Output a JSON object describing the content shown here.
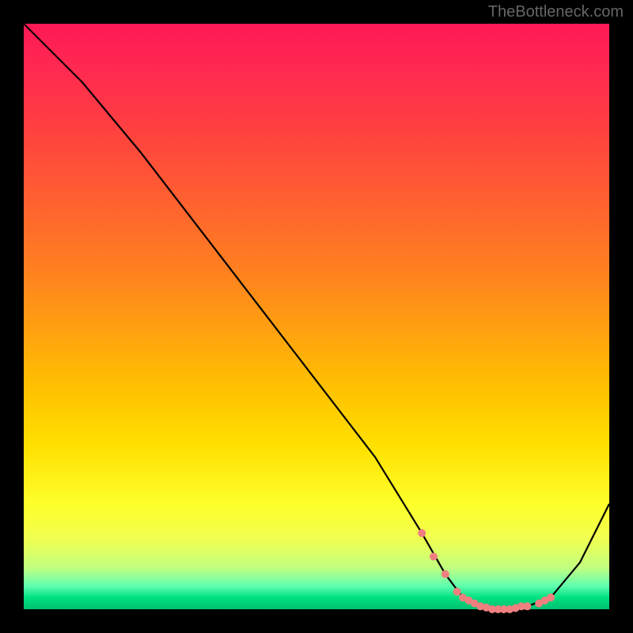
{
  "watermark": "TheBottleneck.com",
  "chart_data": {
    "type": "line",
    "title": "",
    "xlabel": "",
    "ylabel": "",
    "xlim": [
      0,
      100
    ],
    "ylim": [
      0,
      100
    ],
    "grid": false,
    "legend": false,
    "series": [
      {
        "name": "bottleneck-curve",
        "color": "#000000",
        "x": [
          0,
          5,
          10,
          20,
          30,
          40,
          50,
          60,
          68,
          72,
          75,
          78,
          80,
          83,
          86,
          90,
          95,
          100
        ],
        "y": [
          100,
          95,
          90,
          78,
          65,
          52,
          39,
          26,
          13,
          6,
          2,
          0.5,
          0,
          0,
          0.5,
          2,
          8,
          18
        ]
      }
    ],
    "markers": {
      "name": "highlight-points",
      "color": "#f08080",
      "x": [
        68,
        70,
        72,
        74,
        75,
        76,
        77,
        78,
        79,
        80,
        81,
        82,
        83,
        84,
        85,
        86,
        88,
        89,
        90
      ],
      "y": [
        13,
        9,
        6,
        3,
        2,
        1.5,
        1,
        0.5,
        0.3,
        0,
        0,
        0,
        0,
        0.2,
        0.5,
        0.5,
        1,
        1.5,
        2
      ]
    },
    "background_gradient": {
      "type": "vertical-heat",
      "stops": [
        {
          "pos": 0,
          "color": "#ff1a55"
        },
        {
          "pos": 50,
          "color": "#ffc000"
        },
        {
          "pos": 85,
          "color": "#feff2a"
        },
        {
          "pos": 100,
          "color": "#00c070"
        }
      ]
    }
  }
}
